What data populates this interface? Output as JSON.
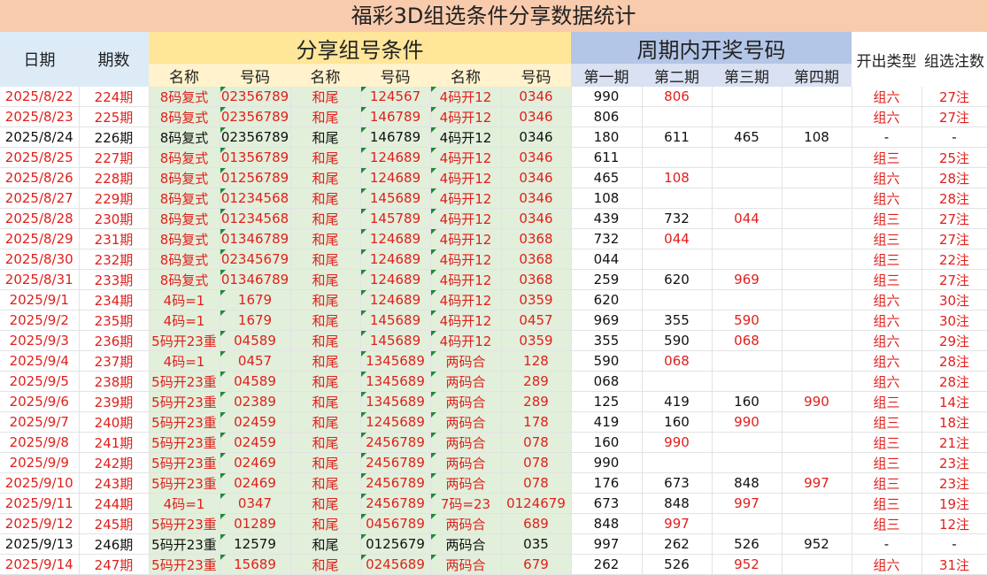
{
  "title": "福彩3D组选条件分享数据统计",
  "headers": {
    "date": "日期",
    "issue": "期数",
    "share_group": "分享组号条件",
    "period_group": "周期内开奖号码",
    "open_type": "开出类型",
    "group_count": "组选注数",
    "name": "名称",
    "code": "号码",
    "p1": "第一期",
    "p2": "第二期",
    "p3": "第三期",
    "p4": "第四期"
  },
  "rows": [
    {
      "date": "2025/8/22",
      "issue": "224期",
      "n1": "8码复式",
      "c1": "02356789",
      "n2": "和尾",
      "c2": "124567",
      "n3": "4码开12",
      "c3": "0346",
      "p1": "990",
      "p2": "806",
      "p3": "",
      "p4": "",
      "type": "组六",
      "count": "27注"
    },
    {
      "date": "2025/8/23",
      "issue": "225期",
      "n1": "8码复式",
      "c1": "02356789",
      "n2": "和尾",
      "c2": "146789",
      "n3": "4码开12",
      "c3": "0346",
      "p1": "806",
      "p2": "",
      "p3": "",
      "p4": "",
      "type": "组六",
      "count": "27注"
    },
    {
      "date": "2025/8/24",
      "issue": "226期",
      "n1": "8码复式",
      "c1": "02356789",
      "n2": "和尾",
      "c2": "146789",
      "n3": "4码开12",
      "c3": "0346",
      "p1": "180",
      "p2": "611",
      "p3": "465",
      "p4": "108",
      "type": "-",
      "count": "-"
    },
    {
      "date": "2025/8/25",
      "issue": "227期",
      "n1": "8码复式",
      "c1": "01356789",
      "n2": "和尾",
      "c2": "124689",
      "n3": "4码开12",
      "c3": "0346",
      "p1": "611",
      "p2": "",
      "p3": "",
      "p4": "",
      "type": "组三",
      "count": "25注"
    },
    {
      "date": "2025/8/26",
      "issue": "228期",
      "n1": "8码复式",
      "c1": "01256789",
      "n2": "和尾",
      "c2": "124689",
      "n3": "4码开12",
      "c3": "0346",
      "p1": "465",
      "p2": "108",
      "p3": "",
      "p4": "",
      "type": "组六",
      "count": "28注"
    },
    {
      "date": "2025/8/27",
      "issue": "229期",
      "n1": "8码复式",
      "c1": "01234568",
      "n2": "和尾",
      "c2": "145689",
      "n3": "4码开12",
      "c3": "0346",
      "p1": "108",
      "p2": "",
      "p3": "",
      "p4": "",
      "type": "组六",
      "count": "28注"
    },
    {
      "date": "2025/8/28",
      "issue": "230期",
      "n1": "8码复式",
      "c1": "01234568",
      "n2": "和尾",
      "c2": "145789",
      "n3": "4码开12",
      "c3": "0346",
      "p1": "439",
      "p2": "732",
      "p3": "044",
      "p4": "",
      "type": "组三",
      "count": "27注"
    },
    {
      "date": "2025/8/29",
      "issue": "231期",
      "n1": "8码复式",
      "c1": "01346789",
      "n2": "和尾",
      "c2": "124689",
      "n3": "4码开12",
      "c3": "0368",
      "p1": "732",
      "p2": "044",
      "p3": "",
      "p4": "",
      "type": "组三",
      "count": "27注"
    },
    {
      "date": "2025/8/30",
      "issue": "232期",
      "n1": "8码复式",
      "c1": "02345679",
      "n2": "和尾",
      "c2": "124689",
      "n3": "4码开12",
      "c3": "0368",
      "p1": "044",
      "p2": "",
      "p3": "",
      "p4": "",
      "type": "组三",
      "count": "22注"
    },
    {
      "date": "2025/8/31",
      "issue": "233期",
      "n1": "8码复式",
      "c1": "01346789",
      "n2": "和尾",
      "c2": "124689",
      "n3": "4码开12",
      "c3": "0368",
      "p1": "259",
      "p2": "620",
      "p3": "969",
      "p4": "",
      "type": "组三",
      "count": "27注"
    },
    {
      "date": "2025/9/1",
      "issue": "234期",
      "n1": "4码=1",
      "c1": "1679",
      "n2": "和尾",
      "c2": "124689",
      "n3": "4码开12",
      "c3": "0359",
      "p1": "620",
      "p2": "",
      "p3": "",
      "p4": "",
      "type": "组六",
      "count": "30注"
    },
    {
      "date": "2025/9/2",
      "issue": "235期",
      "n1": "4码=1",
      "c1": "1679",
      "n2": "和尾",
      "c2": "145689",
      "n3": "4码开12",
      "c3": "0457",
      "p1": "969",
      "p2": "355",
      "p3": "590",
      "p4": "",
      "type": "组六",
      "count": "30注"
    },
    {
      "date": "2025/9/3",
      "issue": "236期",
      "n1": "5码开23重",
      "c1": "04589",
      "n2": "和尾",
      "c2": "145689",
      "n3": "4码开12",
      "c3": "0359",
      "p1": "355",
      "p2": "590",
      "p3": "068",
      "p4": "",
      "type": "组六",
      "count": "29注"
    },
    {
      "date": "2025/9/4",
      "issue": "237期",
      "n1": "4码=1",
      "c1": "0457",
      "n2": "和尾",
      "c2": "1345689",
      "n3": "两码合",
      "c3": "128",
      "p1": "590",
      "p2": "068",
      "p3": "",
      "p4": "",
      "type": "组六",
      "count": "28注"
    },
    {
      "date": "2025/9/5",
      "issue": "238期",
      "n1": "5码开23重",
      "c1": "04589",
      "n2": "和尾",
      "c2": "1345689",
      "n3": "两码合",
      "c3": "289",
      "p1": "068",
      "p2": "",
      "p3": "",
      "p4": "",
      "type": "组六",
      "count": "28注"
    },
    {
      "date": "2025/9/6",
      "issue": "239期",
      "n1": "5码开23重",
      "c1": "02389",
      "n2": "和尾",
      "c2": "1345689",
      "n3": "两码合",
      "c3": "289",
      "p1": "125",
      "p2": "419",
      "p3": "160",
      "p4": "990",
      "type": "组三",
      "count": "14注"
    },
    {
      "date": "2025/9/7",
      "issue": "240期",
      "n1": "5码开23重",
      "c1": "02459",
      "n2": "和尾",
      "c2": "1245689",
      "n3": "两码合",
      "c3": "178",
      "p1": "419",
      "p2": "160",
      "p3": "990",
      "p4": "",
      "type": "组三",
      "count": "18注"
    },
    {
      "date": "2025/9/8",
      "issue": "241期",
      "n1": "5码开23重",
      "c1": "02459",
      "n2": "和尾",
      "c2": "2456789",
      "n3": "两码合",
      "c3": "078",
      "p1": "160",
      "p2": "990",
      "p3": "",
      "p4": "",
      "type": "组三",
      "count": "21注"
    },
    {
      "date": "2025/9/9",
      "issue": "242期",
      "n1": "5码开23重",
      "c1": "02469",
      "n2": "和尾",
      "c2": "2456789",
      "n3": "两码合",
      "c3": "078",
      "p1": "990",
      "p2": "",
      "p3": "",
      "p4": "",
      "type": "组三",
      "count": "23注"
    },
    {
      "date": "2025/9/10",
      "issue": "243期",
      "n1": "5码开23重",
      "c1": "02469",
      "n2": "和尾",
      "c2": "2456789",
      "n3": "两码合",
      "c3": "078",
      "p1": "176",
      "p2": "673",
      "p3": "848",
      "p4": "997",
      "type": "组三",
      "count": "23注"
    },
    {
      "date": "2025/9/11",
      "issue": "244期",
      "n1": "4码=1",
      "c1": "0347",
      "n2": "和尾",
      "c2": "2456789",
      "n3": "7码=23",
      "c3": "0124679",
      "p1": "673",
      "p2": "848",
      "p3": "997",
      "p4": "",
      "type": "组三",
      "count": "19注"
    },
    {
      "date": "2025/9/12",
      "issue": "245期",
      "n1": "5码开23重",
      "c1": "01289",
      "n2": "和尾",
      "c2": "0456789",
      "n3": "两码合",
      "c3": "689",
      "p1": "848",
      "p2": "997",
      "p3": "",
      "p4": "",
      "type": "组三",
      "count": "12注"
    },
    {
      "date": "2025/9/13",
      "issue": "246期",
      "n1": "5码开23重",
      "c1": "12579",
      "n2": "和尾",
      "c2": "0125679",
      "n3": "两码合",
      "c3": "035",
      "p1": "997",
      "p2": "262",
      "p3": "526",
      "p4": "952",
      "type": "-",
      "count": "-"
    },
    {
      "date": "2025/9/14",
      "issue": "247期",
      "n1": "5码开23重",
      "c1": "15689",
      "n2": "和尾",
      "c2": "0245689",
      "n3": "两码合",
      "c3": "679",
      "p1": "262",
      "p2": "526",
      "p3": "952",
      "p4": "",
      "type": "组六",
      "count": "31注"
    }
  ]
}
